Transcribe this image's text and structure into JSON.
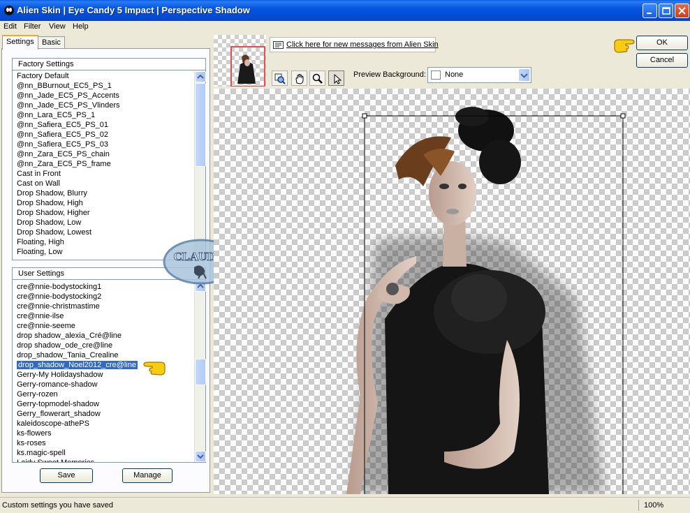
{
  "window": {
    "title": "Alien Skin  |  Eye Candy 5 Impact  |  Perspective Shadow"
  },
  "menu": [
    "Edit",
    "Filter",
    "View",
    "Help"
  ],
  "tabs": {
    "settings": "Settings",
    "basic": "Basic"
  },
  "factory_settings": {
    "title": "Factory Settings",
    "items": [
      "Factory Default",
      "@nn_BBurnout_EC5_PS_1",
      "@nn_Jade_EC5_PS_Accents",
      "@nn_Jade_EC5_PS_Vlinders",
      "@nn_Lara_EC5_PS_1",
      "@nn_Safiera_EC5_PS_01",
      "@nn_Safiera_EC5_PS_02",
      "@nn_Safiera_EC5_PS_03",
      "@nn_Zara_EC5_PS_chain",
      "@nn_Zara_EC5_PS_frame",
      "Cast in Front",
      "Cast on Wall",
      "Drop Shadow, Blurry",
      "Drop Shadow, High",
      "Drop Shadow, Higher",
      "Drop Shadow, Low",
      "Drop Shadow, Lowest",
      "Floating, High",
      "Floating, Low"
    ]
  },
  "user_settings": {
    "title": "User Settings",
    "items": [
      "cre@nnie-bodystocking1",
      "cre@nnie-bodystocking2",
      "cre@nnie-christmastime",
      "cre@nnie-ilse",
      "cre@nnie-seeme",
      "drop shadow_alexia_Cré@line",
      "drop shadow_ode_cre@line",
      "drop_shadow_Tania_Crealine",
      "drop_shadow_Noel2012_cre@line",
      "Gerry-My Holidayshadow",
      "Gerry-romance-shadow",
      "Gerry-rozen",
      "Gerry-topmodel-shadow",
      "Gerry_flowerart_shadow",
      "kaleidoscope-athePS",
      "ks-flowers",
      "ks-roses",
      "ks.magic-spell",
      "Laidy Sweet Memories"
    ],
    "selected_index": 8
  },
  "buttons": {
    "save": "Save",
    "manage": "Manage",
    "ok": "OK",
    "cancel": "Cancel"
  },
  "messages_link": "Click here for new messages from Alien Skin",
  "preview_background": {
    "label": "Preview Background:",
    "value": "None"
  },
  "watermark": {
    "text": "CLAUDIA"
  },
  "status": {
    "text": "Custom settings you have saved",
    "zoom": "100%"
  },
  "colors": {
    "titlebar": "#0455e0",
    "selection": "#316ac5",
    "accent_tab": "#f9a813"
  }
}
